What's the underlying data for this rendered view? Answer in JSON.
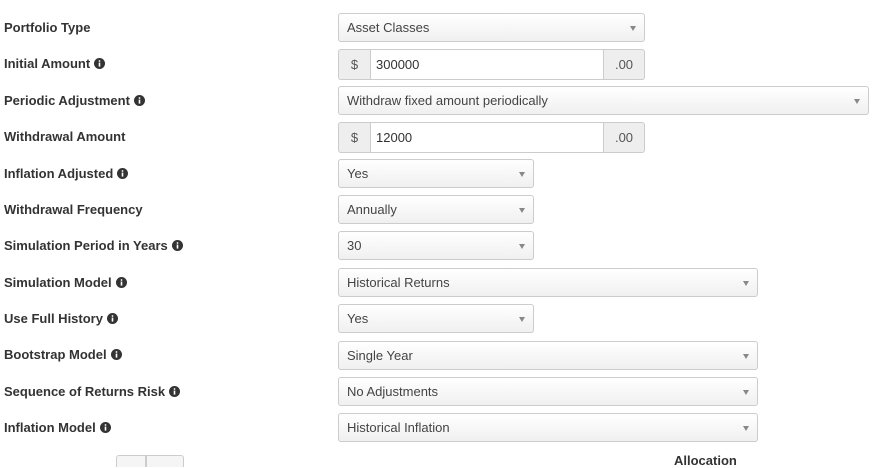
{
  "fields": {
    "portfolio_type": {
      "label": "Portfolio Type",
      "value": "Asset Classes"
    },
    "initial_amount": {
      "label": "Initial Amount",
      "prefix": "$",
      "value": "300000",
      "suffix": ".00"
    },
    "periodic_adjustment": {
      "label": "Periodic Adjustment",
      "value": "Withdraw fixed amount periodically"
    },
    "withdrawal_amount": {
      "label": "Withdrawal Amount",
      "prefix": "$",
      "value": "12000",
      "suffix": ".00"
    },
    "inflation_adjusted": {
      "label": "Inflation Adjusted",
      "value": "Yes"
    },
    "withdrawal_frequency": {
      "label": "Withdrawal Frequency",
      "value": "Annually"
    },
    "simulation_period": {
      "label": "Simulation Period in Years",
      "value": "30"
    },
    "simulation_model": {
      "label": "Simulation Model",
      "value": "Historical Returns"
    },
    "use_full_history": {
      "label": "Use Full History",
      "value": "Yes"
    },
    "bootstrap_model": {
      "label": "Bootstrap Model",
      "value": "Single Year"
    },
    "sequence_risk": {
      "label": "Sequence of Returns Risk",
      "value": "No Adjustments"
    },
    "inflation_model": {
      "label": "Inflation Model",
      "value": "Historical Inflation"
    }
  },
  "footer": {
    "allocation_header": "Allocation"
  },
  "icons": {
    "info": "info-circle-icon",
    "caret": "caret-down-icon"
  },
  "colors": {
    "border": "#cccccc",
    "addon_bg": "#eeeeee",
    "text": "#333333"
  }
}
